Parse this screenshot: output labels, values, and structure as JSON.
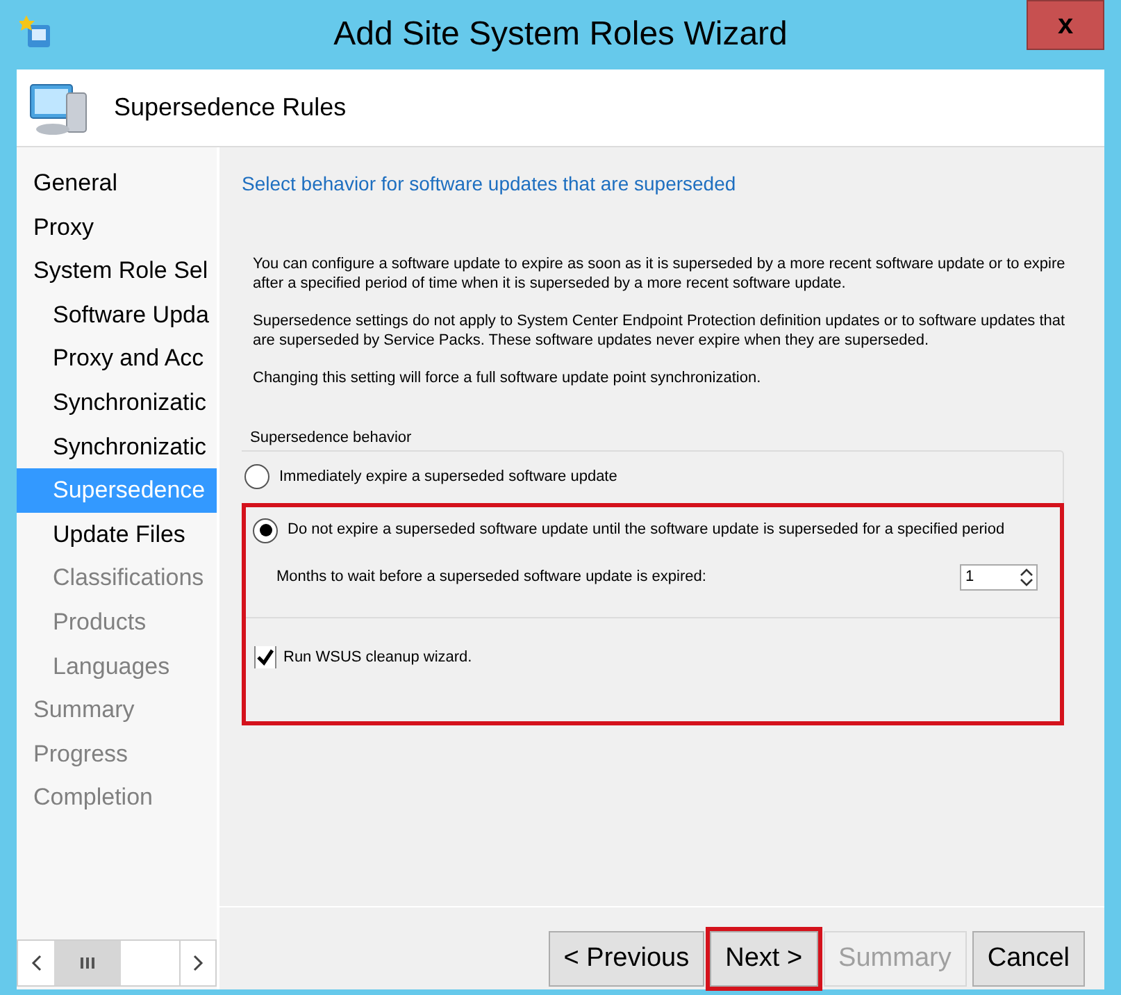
{
  "window": {
    "title": "Add Site System Roles Wizard",
    "close": "x"
  },
  "header": {
    "title": "Supersedence Rules"
  },
  "nav": [
    {
      "label": "General",
      "selected": false,
      "disabled": false
    },
    {
      "label": "Proxy",
      "selected": false,
      "disabled": false
    },
    {
      "label": "System Role Sel",
      "selected": false,
      "disabled": false,
      "children": [
        {
          "label": "Software Upda",
          "selected": false,
          "disabled": false
        },
        {
          "label": "Proxy and Acc",
          "selected": false,
          "disabled": false
        },
        {
          "label": "Synchronizatic",
          "selected": false,
          "disabled": false
        },
        {
          "label": "Synchronizatic",
          "selected": false,
          "disabled": false
        },
        {
          "label": "Supersedence",
          "selected": true,
          "disabled": false
        },
        {
          "label": "Update Files",
          "selected": false,
          "disabled": false
        },
        {
          "label": "Classifications",
          "selected": false,
          "disabled": true
        },
        {
          "label": "Products",
          "selected": false,
          "disabled": true
        },
        {
          "label": "Languages",
          "selected": false,
          "disabled": true
        }
      ]
    },
    {
      "label": "Summary",
      "selected": false,
      "disabled": true
    },
    {
      "label": "Progress",
      "selected": false,
      "disabled": true
    },
    {
      "label": "Completion",
      "selected": false,
      "disabled": true
    }
  ],
  "content": {
    "heading": "Select behavior for software updates that are superseded",
    "paragraphs": [
      "You can configure a software update to expire as soon as it is superseded by a more recent software update or to expire after a specified period of time when it is superseded by a more recent software update.",
      "Supersedence settings do not apply to System Center Endpoint Protection definition updates or to software updates that are superseded by Service Packs. These software updates never expire when they are superseded.",
      "Changing this setting will force a full software update point synchronization."
    ],
    "group": {
      "title": "Supersedence behavior",
      "highlighted": true,
      "options": [
        {
          "label": "Immediately expire a superseded software update",
          "selected": false
        },
        {
          "label": "Do not expire a superseded software update until the software update is superseded for a specified period",
          "selected": true
        }
      ],
      "months": {
        "label": "Months to wait before a superseded software update is expired:",
        "value": "1"
      },
      "cleanup": {
        "label": "Run WSUS cleanup wizard.",
        "checked": true
      }
    }
  },
  "buttons": [
    {
      "label": "< Previous",
      "disabled": false,
      "highlighted": false
    },
    {
      "label": "Next >",
      "disabled": false,
      "highlighted": true
    },
    {
      "label": "Summary",
      "disabled": true,
      "highlighted": false
    },
    {
      "label": "Cancel",
      "disabled": false,
      "highlighted": false
    }
  ]
}
